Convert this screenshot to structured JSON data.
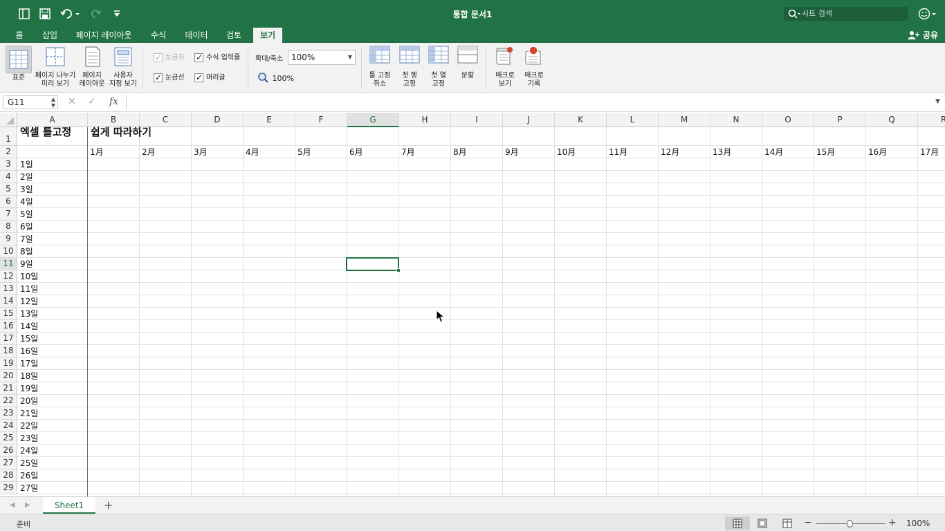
{
  "window": {
    "title": "통합 문서1",
    "search_placeholder": "시트 검색"
  },
  "colors": {
    "accent": "#217346",
    "ribbon_bg": "#f2f2f2",
    "grid_line": "#e1e1e1"
  },
  "tabs": [
    {
      "label": "홈"
    },
    {
      "label": "삽입"
    },
    {
      "label": "페이지 레이아웃"
    },
    {
      "label": "수식"
    },
    {
      "label": "데이터"
    },
    {
      "label": "검토"
    },
    {
      "label": "보기",
      "active": true
    }
  ],
  "share_label": "공유",
  "ribbon": {
    "views": [
      "표준",
      "페이지 나누기\n미리 보기",
      "페이지\n레이아웃",
      "사용자\n지정 보기"
    ],
    "show": {
      "ruler": "눈금자",
      "formula_bar": "수식 입력줄",
      "gridlines": "눈금선",
      "headings": "머리글"
    },
    "zoom_label": "확대/축소",
    "zoom_value": "100%",
    "zoom100_label": "100%",
    "freeze": [
      "틀 고정\n취소",
      "첫 행\n고정",
      "첫 열\n고정",
      "분할"
    ],
    "macros": [
      "매크로\n보기",
      "매크로\n기록"
    ]
  },
  "formula": {
    "namebox": "G11",
    "fx": "fx",
    "value": ""
  },
  "grid": {
    "columns": [
      "A",
      "B",
      "C",
      "D",
      "E",
      "F",
      "G",
      "H",
      "I",
      "J",
      "K",
      "L",
      "M",
      "N",
      "O",
      "P",
      "Q",
      "R"
    ],
    "selected_column": "G",
    "selected_row": "11",
    "rows": [
      "1",
      "2",
      "3",
      "4",
      "5",
      "6",
      "7",
      "8",
      "9",
      "10",
      "11",
      "12",
      "13",
      "14",
      "15",
      "16",
      "17",
      "18",
      "19",
      "20",
      "21",
      "22",
      "23",
      "24",
      "25",
      "26",
      "27",
      "28",
      "29"
    ],
    "a1": "엑셀 틀고정",
    "b1": "쉽게 따라하기",
    "months": [
      "1月",
      "2月",
      "3月",
      "4月",
      "5月",
      "6月",
      "7月",
      "8月",
      "9月",
      "10月",
      "11月",
      "12月",
      "13月",
      "14月",
      "15月",
      "16月",
      "17月"
    ],
    "days": [
      "1일",
      "2일",
      "3일",
      "4일",
      "5일",
      "6일",
      "7일",
      "8일",
      "9일",
      "10일",
      "11일",
      "12일",
      "13일",
      "14일",
      "15일",
      "16일",
      "17일",
      "18일",
      "19일",
      "20일",
      "21일",
      "22일",
      "23일",
      "24일",
      "25일",
      "26일",
      "27일"
    ]
  },
  "sheets": [
    {
      "name": "Sheet1"
    }
  ],
  "status": {
    "text": "준비",
    "zoom": "100%"
  }
}
